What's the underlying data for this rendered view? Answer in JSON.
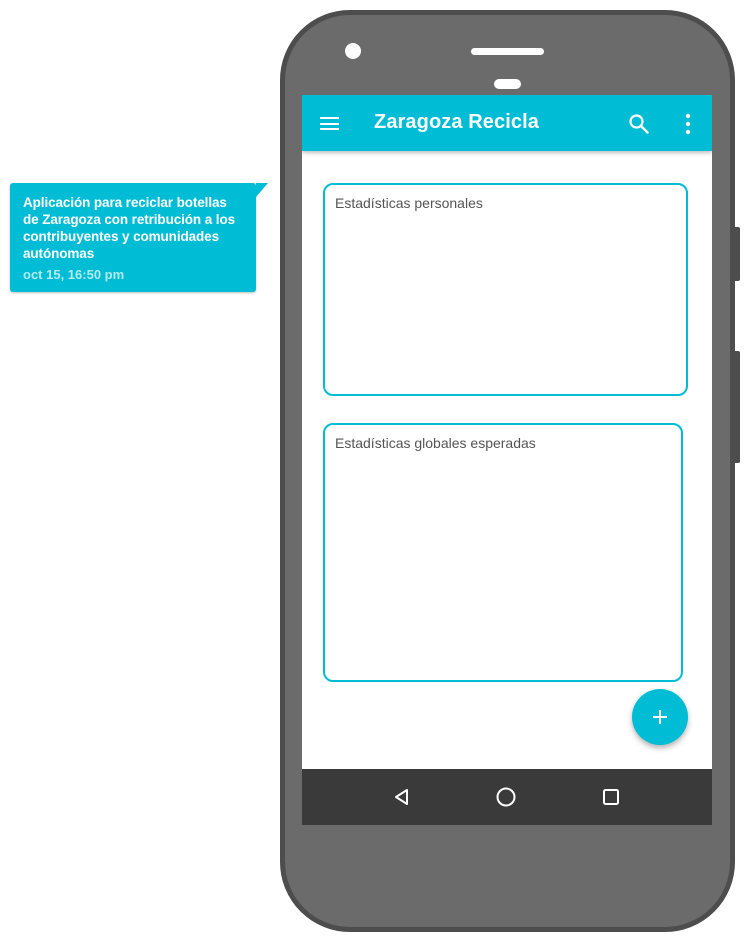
{
  "comment": {
    "text": "Aplicación para reciclar botellas de Zaragoza con retribución a los contribuyentes y comunidades autónomas",
    "timestamp": "oct 15, 16:50 pm",
    "color": "#00bcd4"
  },
  "app": {
    "title": "Zaragoza Recicla",
    "accent_color": "#00bcd4",
    "icons": {
      "menu": "menu-icon",
      "search": "search-icon",
      "more": "more-vert-icon",
      "fab": "add-icon"
    }
  },
  "cards": [
    {
      "label": "Estadísticas personales"
    },
    {
      "label": "Estadísticas globales esperadas"
    }
  ],
  "navigation": {
    "buttons": [
      "back-icon",
      "home-icon",
      "recents-icon"
    ]
  }
}
